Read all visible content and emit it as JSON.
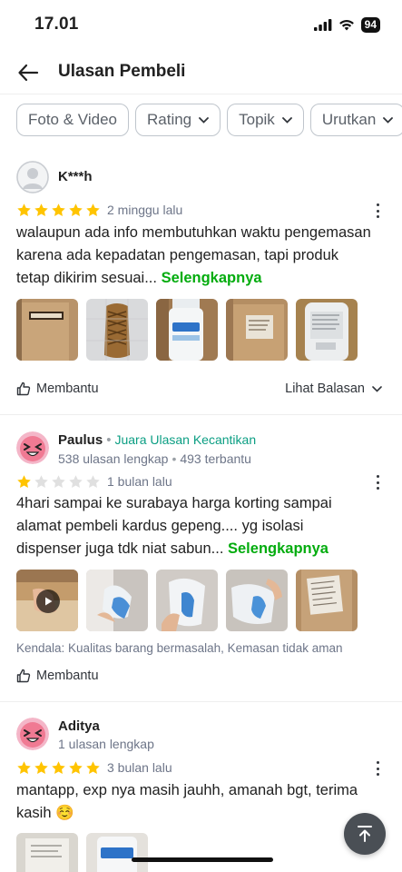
{
  "status_bar": {
    "time": "17.01",
    "battery": "94"
  },
  "header": {
    "title": "Ulasan Pembeli"
  },
  "filters": [
    "Foto & Video",
    "Rating",
    "Topik",
    "Urutkan"
  ],
  "reviews": [
    {
      "name": "K***h",
      "rating": 5,
      "time": "2 minggu lalu",
      "text": "walaupun ada info membutuhkan waktu pengemasan karena ada kepadatan pengemasan, tapi produk tetap dikirim sesuai...",
      "more": "Selengkapnya",
      "helpful": "Membantu",
      "see_reply": "Lihat Balasan"
    },
    {
      "name": "Paulus",
      "badge": "Juara Ulasan Kecantikan",
      "reviews_count": "538 ulasan lengkap",
      "helpful_count": "493 terbantu",
      "rating": 1,
      "time": "1 bulan lalu",
      "text": "4hari sampai ke surabaya harga korting sampai alamat pembeli kardus gepeng.... yg isolasi dispenser juga tdk niat sabun...",
      "more": "Selengkapnya",
      "kendala": "Kendala: Kualitas barang bermasalah, Kemasan tidak aman",
      "helpful": "Membantu"
    },
    {
      "name": "Aditya",
      "reviews_count": "1 ulasan lengkap",
      "rating": 5,
      "time": "3 bulan lalu",
      "text": "mantapp, exp nya masih jauhh, amanah bgt, terima kasih ☺️"
    }
  ],
  "colors": {
    "star": "#ffc400",
    "star_empty": "#e0e0e0",
    "accent_green": "#03ac0e",
    "badge_teal": "#0b9e83"
  }
}
